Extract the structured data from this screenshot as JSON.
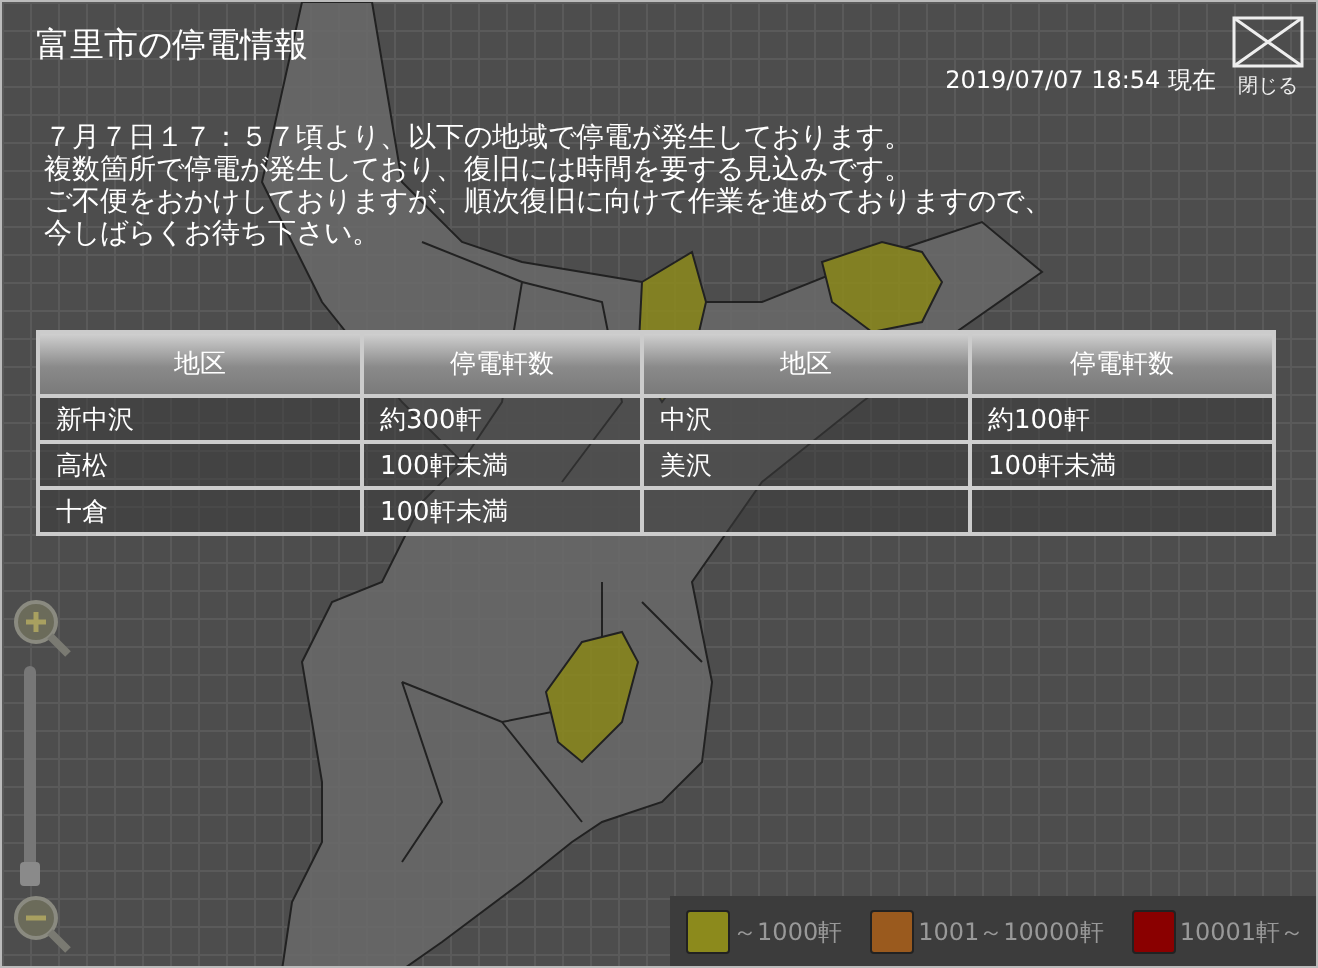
{
  "window": {
    "title": "富里市の停電情報",
    "close_label": "閉じる"
  },
  "timestamp": "2019/07/07 18:54 現在",
  "message": [
    "７月７日１７：５７頃より、以下の地域で停電が発生しております。",
    "複数箇所で停電が発生しており、復旧には時間を要する見込みです。",
    "ご不便をおかけしておりますが、順次復旧に向けて作業を進めておりますので、",
    "今しばらくお待ち下さい。"
  ],
  "table": {
    "columns": [
      "地区",
      "停電軒数",
      "地区",
      "停電軒数"
    ],
    "rows": [
      [
        "新中沢",
        "約300軒",
        "中沢",
        "約100軒"
      ],
      [
        "高松",
        "100軒未満",
        "美沢",
        "100軒未満"
      ],
      [
        "十倉",
        "100軒未満",
        "",
        ""
      ]
    ]
  },
  "zoom": {
    "level": 0
  },
  "legend": [
    {
      "label": "～1000軒",
      "color": "#8c8a1c"
    },
    {
      "label": "1001～10000軒",
      "color": "#9a5a1e"
    },
    {
      "label": "10001軒～",
      "color": "#8a0000"
    }
  ]
}
